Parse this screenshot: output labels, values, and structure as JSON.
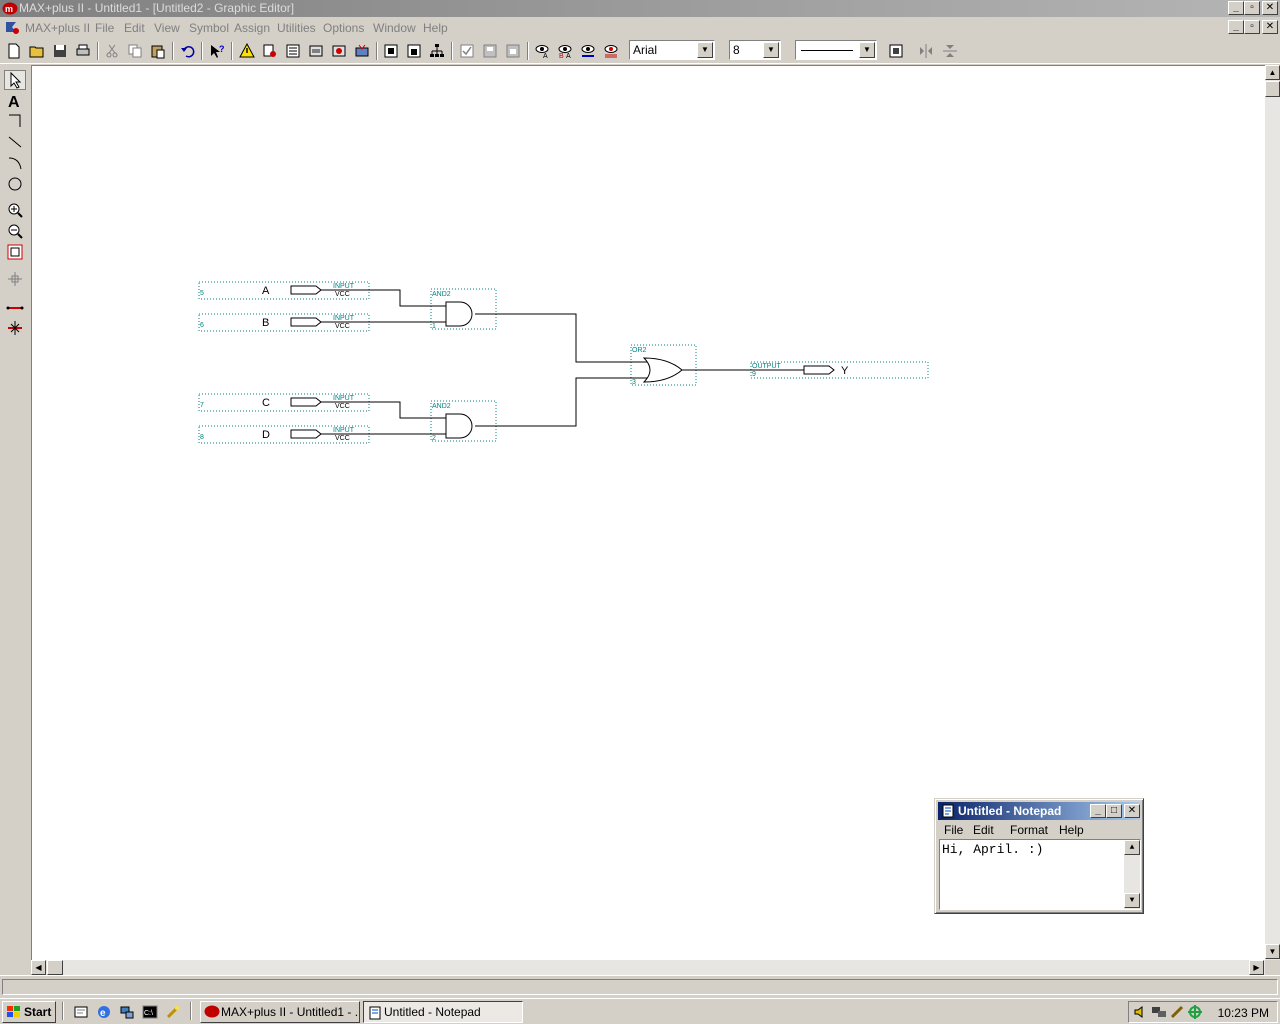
{
  "window": {
    "title": "MAX+plus II - Untitled1 - [Untitled2 - Graphic Editor]"
  },
  "menubar": {
    "app_label": "MAX+plus II",
    "items": [
      "File",
      "Edit",
      "View",
      "Symbol",
      "Assign",
      "Utilities",
      "Options",
      "Window",
      "Help"
    ]
  },
  "toolbar": {
    "font_name": "Arial",
    "font_size": "8",
    "line_style": "solid-line"
  },
  "schematic": {
    "inputs": [
      {
        "name": "A",
        "pin": "5",
        "prim": "INPUT",
        "sub": "VCC"
      },
      {
        "name": "B",
        "pin": "6",
        "prim": "INPUT",
        "sub": "VCC"
      },
      {
        "name": "C",
        "pin": "7",
        "prim": "INPUT",
        "sub": "VCC"
      },
      {
        "name": "D",
        "pin": "8",
        "prim": "INPUT",
        "sub": "VCC"
      }
    ],
    "gates": [
      {
        "type": "AND2",
        "num": "1"
      },
      {
        "type": "AND2",
        "num": "2"
      },
      {
        "type": "OR2",
        "num": "3"
      }
    ],
    "output": {
      "name": "Y",
      "prim": "OUTPUT",
      "pin": "9"
    }
  },
  "notepad": {
    "title": "Untitled - Notepad",
    "menu": [
      "File",
      "Edit",
      "Format",
      "Help"
    ],
    "text": "Hi, April. :)"
  },
  "taskbar": {
    "start_label": "Start",
    "tasks": [
      {
        "label": "MAX+plus II - Untitled1 - ..."
      },
      {
        "label": "Untitled - Notepad"
      }
    ],
    "clock": "10:23 PM"
  },
  "colors": {
    "face": "#d4d0c8",
    "active_title": "#0a246a",
    "inactive_title": "#808080",
    "schematic_label": "#008080",
    "app_icon_red": "#c00000"
  }
}
